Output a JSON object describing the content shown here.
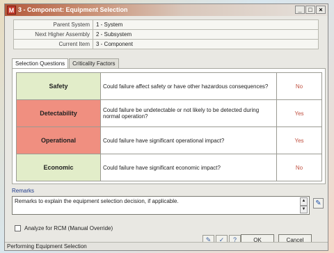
{
  "window": {
    "app_icon": "M",
    "title": "3 - Component: Equipment Selection",
    "minimize": "_",
    "maximize": "□",
    "close": "×"
  },
  "header_fields": [
    {
      "label": "Parent System",
      "value": "1 - System"
    },
    {
      "label": "Next Higher Assembly",
      "value": "2 - Subsystem"
    },
    {
      "label": "Current Item",
      "value": "3 - Component"
    }
  ],
  "tabs": [
    {
      "label": "Selection Questions",
      "active": true
    },
    {
      "label": "Criticality Factors",
      "active": false
    }
  ],
  "questions": [
    {
      "category": "Safety",
      "color": "#e2edc9",
      "question": "Could failure affect safety or have other hazardous consequences?",
      "answer": "No"
    },
    {
      "category": "Detectability",
      "color": "#f08f80",
      "question": "Could failure be undetectable or not likely to be detected during normal operation?",
      "answer": "Yes"
    },
    {
      "category": "Operational",
      "color": "#f08f80",
      "question": "Could failure have significant operational impact?",
      "answer": "Yes"
    },
    {
      "category": "Economic",
      "color": "#e2edc9",
      "question": "Could failure have significant economic impact?",
      "answer": "No"
    }
  ],
  "remarks": {
    "label": "Remarks",
    "value": "Remarks to explain the equipment selection decision, if applicable."
  },
  "override": {
    "label": "Analyze for RCM (Manual Override)",
    "checked": false
  },
  "buttons": {
    "ok": "OK",
    "cancel": "Cancel"
  },
  "toolbar_icons": [
    "edit-icon",
    "spellcheck-icon",
    "help-icon"
  ],
  "status": "Performing Equipment Selection"
}
